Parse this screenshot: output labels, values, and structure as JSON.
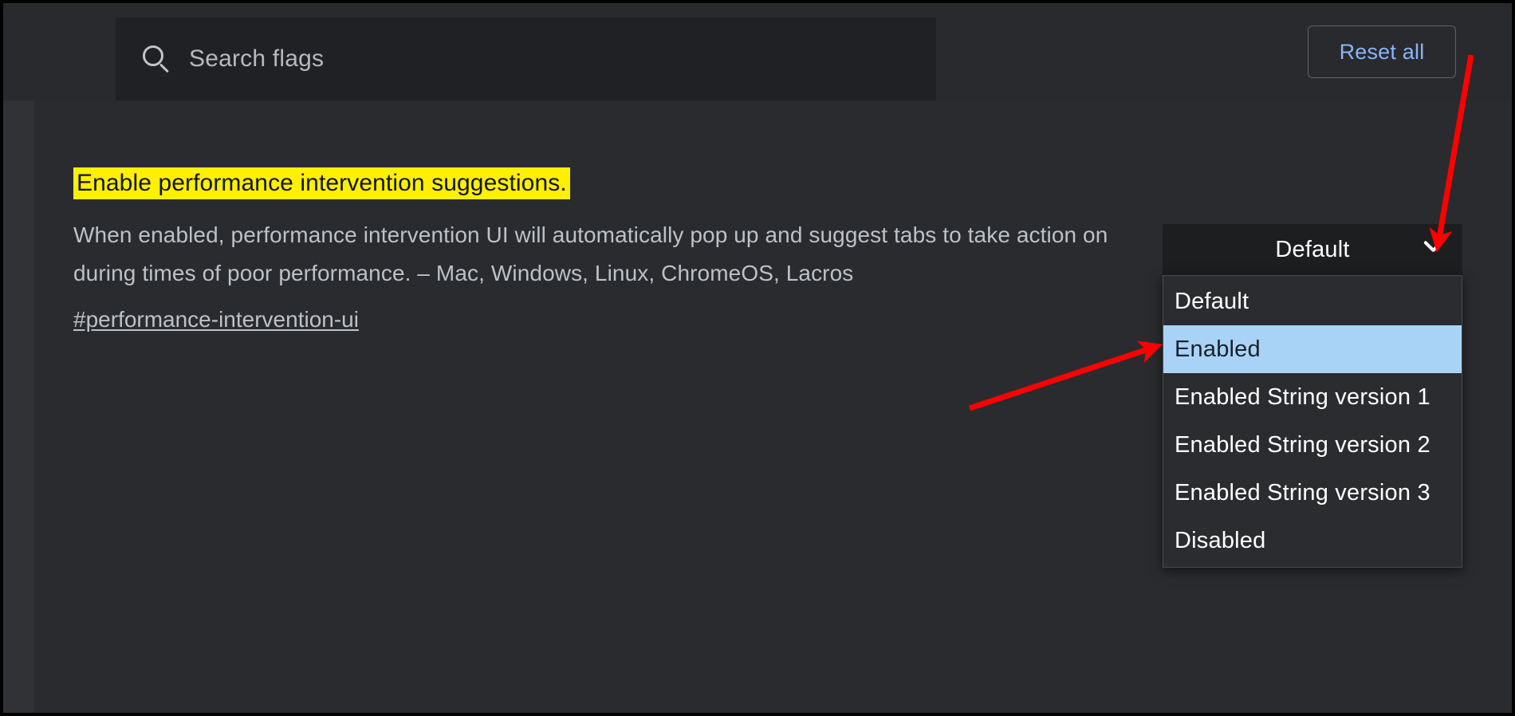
{
  "page": {
    "background_color": "#292a2d",
    "panel_color": "#2a2b2e"
  },
  "toolbar": {
    "search": {
      "icon": "search-icon",
      "placeholder": "Search flags",
      "value": ""
    },
    "reset_all_label": "Reset all",
    "reset_all_color": "#8ab4f8"
  },
  "flag": {
    "title": "Enable performance intervention suggestions.",
    "title_highlight_color": "#fdf000",
    "description": "When enabled, performance intervention UI will automatically pop up and suggest tabs to take action on during times of poor performance. – Mac, Windows, Linux, ChromeOS, Lacros",
    "permalink": "#performance-intervention-ui"
  },
  "select": {
    "selected_value": "Default",
    "chevron_icon": "chevron-down-icon",
    "expanded": true,
    "highlighted_index": 1,
    "highlight_color": "#a8d3f7",
    "options": [
      {
        "label": "Default"
      },
      {
        "label": "Enabled"
      },
      {
        "label": "Enabled String version 1"
      },
      {
        "label": "Enabled String version 2"
      },
      {
        "label": "Enabled String version 3"
      },
      {
        "label": "Disabled"
      }
    ]
  },
  "annotations": {
    "color": "#ff0000",
    "arrows": [
      {
        "name": "arrow-to-chevron",
        "points_to": "chevron-down-icon"
      },
      {
        "name": "arrow-to-enabled-option",
        "points_to": "dropdown-option-enabled"
      }
    ]
  }
}
